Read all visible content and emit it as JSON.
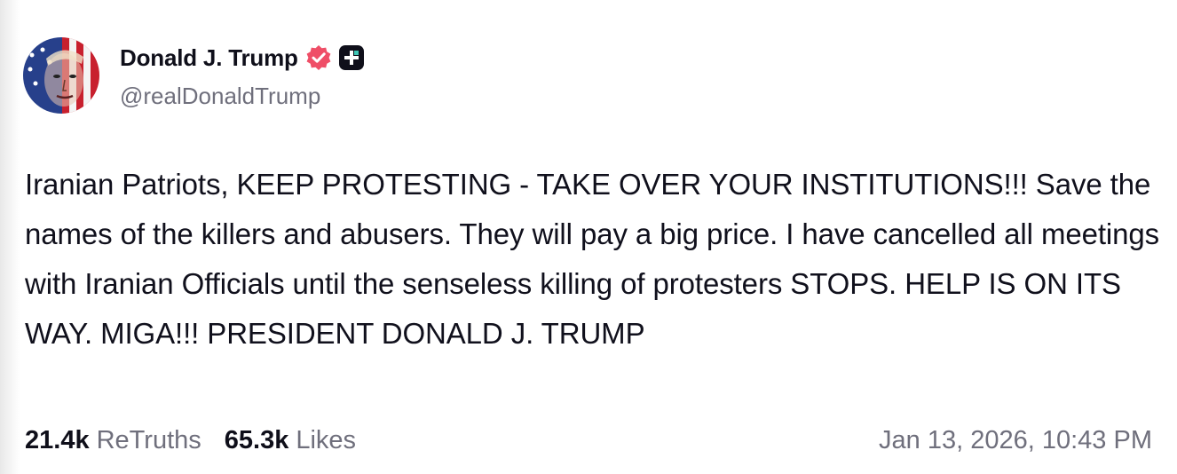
{
  "author": {
    "display_name": "Donald J. Trump",
    "handle": "@realDonaldTrump",
    "verified_badge_icon": "verified-badge-icon",
    "plus_badge_icon": "plus-badge-icon",
    "verified_color": "#ef4e67"
  },
  "post": {
    "text": "Iranian Patriots, KEEP PROTESTING - TAKE OVER YOUR INSTITUTIONS!!! Save the names of the killers and abusers. They will pay a big price. I have cancelled all meetings with Iranian Officials until the senseless killing of protesters STOPS. HELP IS ON ITS WAY. MIGA!!! PRESIDENT DONALD J. TRUMP"
  },
  "stats": {
    "retruths_count": "21.4k",
    "retruths_label": "ReTruths",
    "likes_count": "65.3k",
    "likes_label": "Likes"
  },
  "timestamp": "Jan 13, 2026, 10:43 PM"
}
